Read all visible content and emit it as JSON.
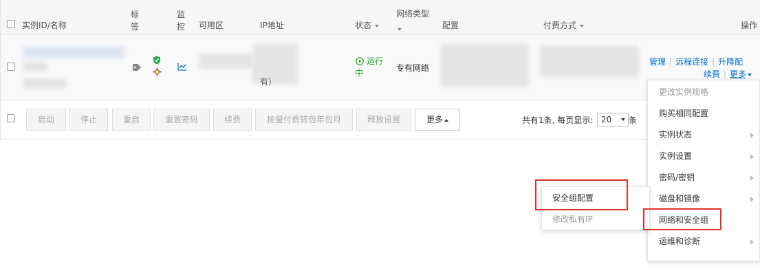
{
  "table": {
    "columns": {
      "instance": "实例ID/名称",
      "tag": "标签",
      "monitor": "监控",
      "zone": "可用区",
      "ip": "IP地址",
      "status": "状态",
      "network_type": "网络类型",
      "config": "配置",
      "billing": "付费方式",
      "actions": "操作"
    },
    "row": {
      "status": "运行中",
      "network": "专有网络",
      "ip_partial": "有)",
      "actions": {
        "manage": "管理",
        "remote": "远程连接",
        "resize": "升降配",
        "renew": "续费",
        "more": "更多"
      }
    }
  },
  "footer": {
    "buttons": [
      "启动",
      "停止",
      "重启",
      "重置密码",
      "续费",
      "按量付费转包年包月",
      "释放设置",
      "更多"
    ],
    "pagination": {
      "total_prefix": "共有1条, 每页显示:",
      "page_size": "20",
      "suffix": "条"
    }
  },
  "dropdown_menu": {
    "items": [
      {
        "label": "更改实例规格",
        "disabled": true,
        "has_submenu": false
      },
      {
        "label": "购买相同配置",
        "disabled": false,
        "has_submenu": false
      },
      {
        "label": "实例状态",
        "disabled": false,
        "has_submenu": true
      },
      {
        "label": "实例设置",
        "disabled": false,
        "has_submenu": true
      },
      {
        "label": "密码/密钥",
        "disabled": false,
        "has_submenu": true
      },
      {
        "label": "磁盘和镜像",
        "disabled": false,
        "has_submenu": true
      },
      {
        "label": "网络和安全组",
        "disabled": false,
        "has_submenu": false
      },
      {
        "label": "运维和诊断",
        "disabled": false,
        "has_submenu": true
      }
    ]
  },
  "submenu": {
    "items": [
      {
        "label": "安全组配置",
        "disabled": false
      },
      {
        "label": "修改私有IP",
        "disabled": true
      }
    ]
  },
  "colors": {
    "link": "#0070cc",
    "running": "#1aa01a",
    "highlight": "#e0302a"
  }
}
